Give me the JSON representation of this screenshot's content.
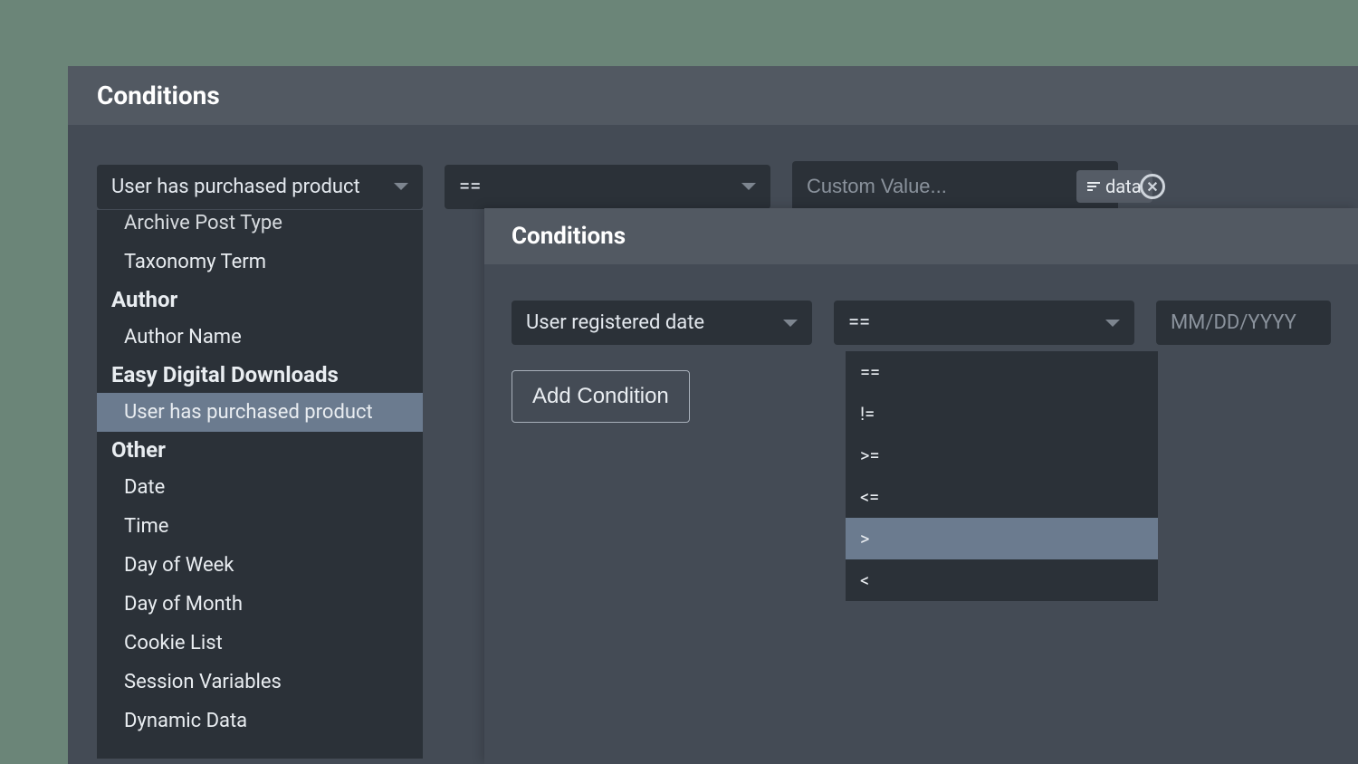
{
  "back": {
    "title": "Conditions",
    "field_select": "User has purchased product",
    "operator_select": "==",
    "value_placeholder": "Custom Value...",
    "data_button": "data",
    "dropdown": {
      "cut_item": "Archive Post Type",
      "items_row1": [
        "Taxonomy Term"
      ],
      "groups": [
        {
          "label": "Author",
          "items": [
            "Author Name"
          ]
        },
        {
          "label": "Easy Digital Downloads",
          "items": [
            "User has purchased product"
          ],
          "highlight": "User has purchased product"
        },
        {
          "label": "Other",
          "items": [
            "Date",
            "Time",
            "Day of Week",
            "Day of Month",
            "Cookie List",
            "Session Variables",
            "Dynamic Data"
          ]
        }
      ]
    }
  },
  "front": {
    "title": "Conditions",
    "field_select": "User registered date",
    "operator_select": "==",
    "date_placeholder": "MM/DD/YYYY",
    "add_button": "Add Condition",
    "op_options": [
      "==",
      "!=",
      ">=",
      "<=",
      ">",
      "<"
    ],
    "op_highlight": ">"
  }
}
